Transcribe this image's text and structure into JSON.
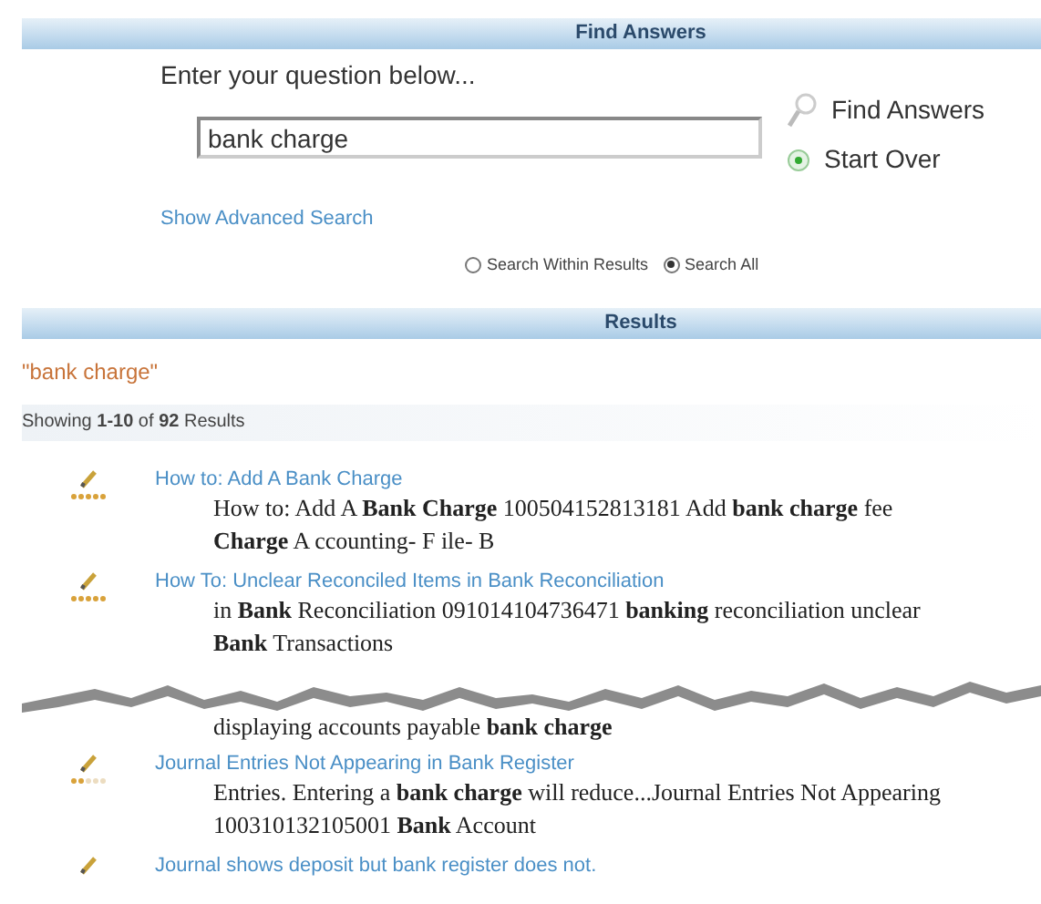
{
  "find_panel": {
    "title": "Find Answers",
    "prompt": "Enter your question below...",
    "search": {
      "value": "bank charge"
    },
    "find_button": "Find Answers",
    "start_over": "Start Over",
    "advanced_link": "Show Advanced Search",
    "scope_options": [
      {
        "label": "Search Within Results",
        "selected": false
      },
      {
        "label": "Search All",
        "selected": true
      }
    ]
  },
  "results_panel": {
    "title": "Results",
    "query": "\"bank charge\"",
    "summary": "Showing **1-10** of **92** Results",
    "results": [
      {
        "title": "How to: Add A Bank Charge",
        "stars": 5,
        "snippet": [
          "How to: Add A **Bank Charge** 100504152813181 Add **bank charge** fee",
          "**Charge** A ccounting- F ile- B"
        ]
      },
      {
        "title": "How To: Unclear Reconciled Items in Bank Reconciliation",
        "stars": 5,
        "snippet": [
          "in **Bank** Reconciliation 091014104736471 **banking** reconciliation unclear",
          "**Bank** Transactions"
        ]
      },
      {
        "torn": true,
        "snippet": [
          "displaying accounts payable **bank charge**"
        ]
      },
      {
        "title": "Journal Entries Not Appearing in Bank Register",
        "stars": 2,
        "snippet": [
          "Entries. Entering a **bank charge** will reduce...Journal Entries Not Appearing",
          "100310132105001 **Bank** Account"
        ]
      },
      {
        "title": "Journal shows deposit but bank register does not."
      }
    ]
  }
}
